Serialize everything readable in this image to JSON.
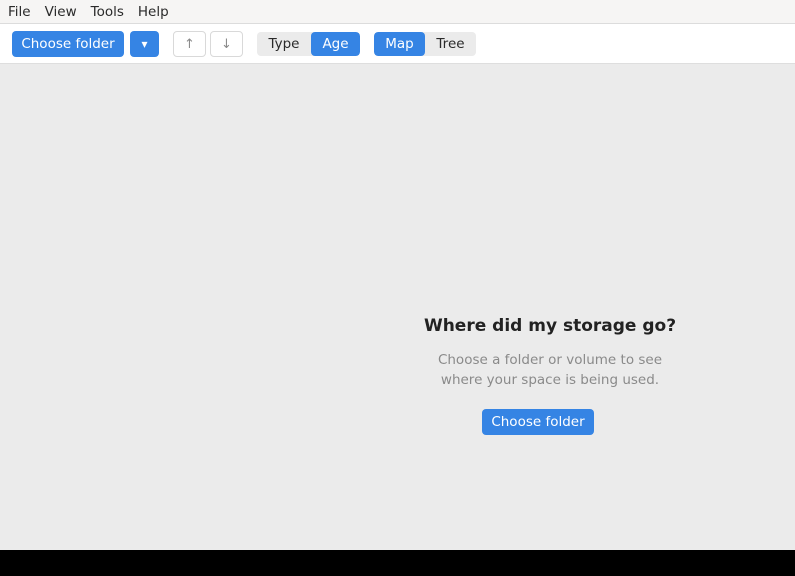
{
  "menubar": {
    "items": [
      "File",
      "View",
      "Tools",
      "Help"
    ]
  },
  "toolbar": {
    "choose_folder_label": "Choose folder",
    "dropdown_glyph": "▾",
    "nav_up_glyph": "↑",
    "nav_down_glyph": "↓",
    "color_mode": {
      "options": [
        "Type",
        "Age"
      ],
      "selected": "Age"
    },
    "view_mode": {
      "options": [
        "Map",
        "Tree"
      ],
      "selected": "Map"
    }
  },
  "empty_state": {
    "title": "Where did my storage go?",
    "description_line1": "Choose a folder or volume to see",
    "description_line2": "where your space is being used.",
    "button_label": "Choose folder"
  },
  "colors": {
    "accent": "#3584e4",
    "content_bg": "#ebebeb",
    "menubar_bg": "#f6f5f4"
  }
}
